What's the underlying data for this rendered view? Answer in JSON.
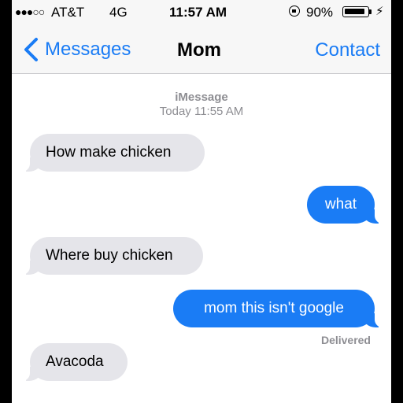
{
  "status_bar": {
    "signal": "●●●○○",
    "carrier": "AT&T",
    "network": "4G",
    "time": "11:57 AM",
    "battery_percent": "90%",
    "battery_level": 0.9,
    "charging_glyph": "⚡"
  },
  "nav": {
    "back_label": "Messages",
    "title": "Mom",
    "contact_label": "Contact"
  },
  "meta": {
    "service": "iMessage",
    "timestamp": "Today 11:55 AM"
  },
  "messages": [
    {
      "direction": "received",
      "text": "How make chicken"
    },
    {
      "direction": "sent",
      "text": "what"
    },
    {
      "direction": "received",
      "text": "Where buy chicken"
    },
    {
      "direction": "sent",
      "text": "mom this isn't google"
    },
    {
      "direction": "received",
      "text": "Avacoda"
    }
  ],
  "delivered_label": "Delivered",
  "colors": {
    "accent": "#1a7cf5",
    "sent_bubble": "#1a7cf5",
    "received_bubble": "#e5e5ea",
    "meta_text": "#8e8e93"
  },
  "icons": [
    "signal-dots-icon",
    "lock-rotation-icon",
    "battery-icon",
    "charging-bolt-icon",
    "back-chevron-icon"
  ]
}
